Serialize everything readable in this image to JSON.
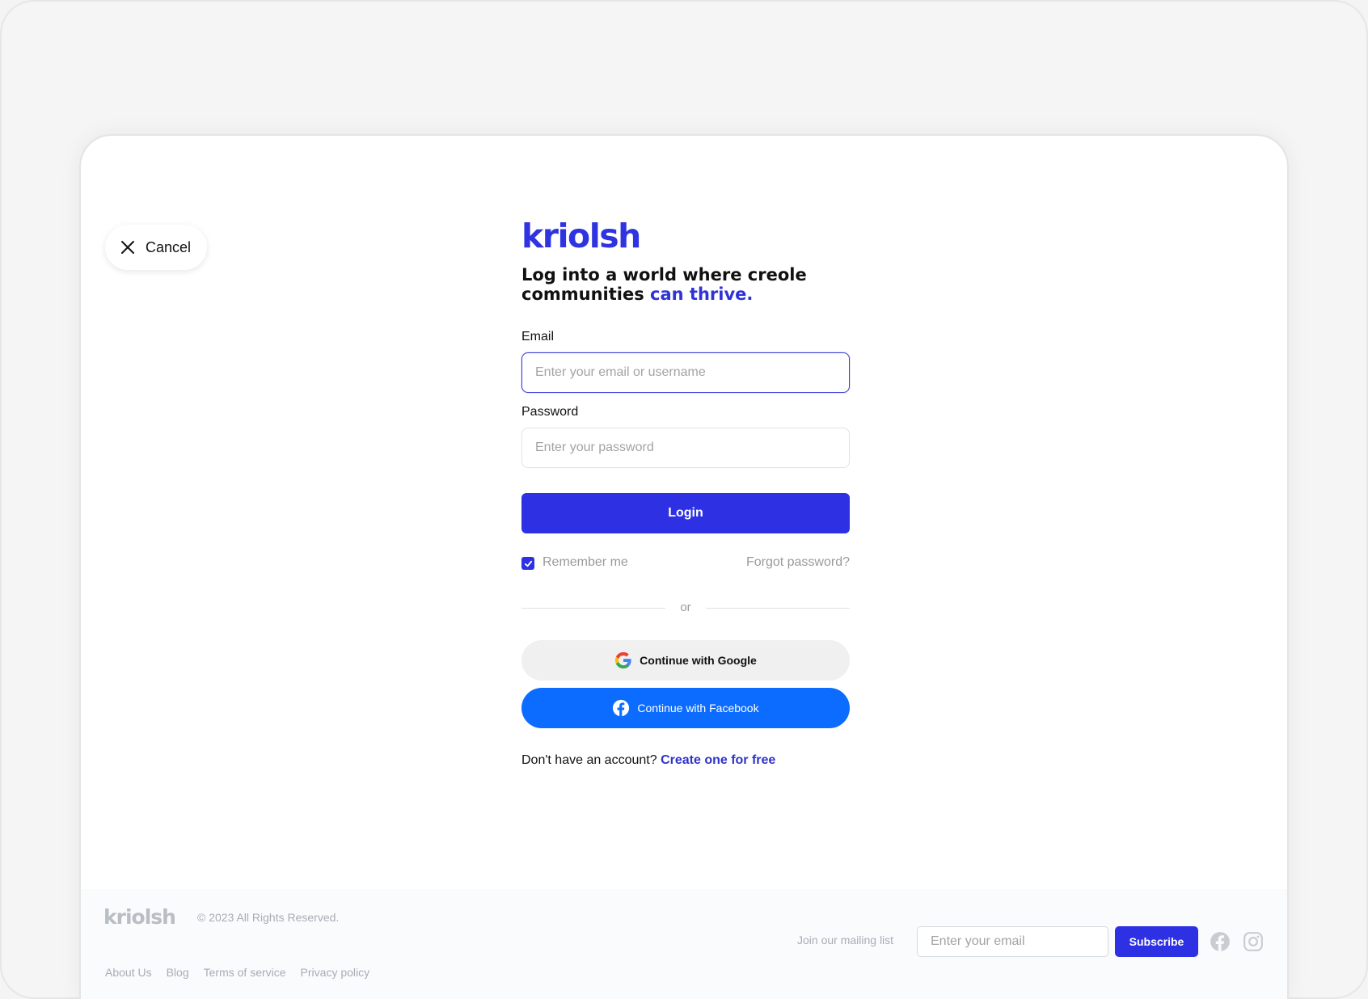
{
  "cancel": {
    "label": "Cancel",
    "icon": "close-icon"
  },
  "brand": {
    "logo_text": "kriolsh",
    "accent_color": "#2e31e3"
  },
  "headline": {
    "part1": "Log into a world where creole communities ",
    "accent": "can thrive."
  },
  "email": {
    "label": "Email",
    "placeholder": "Enter your email or username",
    "value": ""
  },
  "password": {
    "label": "Password",
    "placeholder": "Enter your password",
    "value": ""
  },
  "login": {
    "label": "Login"
  },
  "remember": {
    "label": "Remember me",
    "checked": true
  },
  "forgot": {
    "label": "Forgot password?"
  },
  "divider": {
    "label": "or"
  },
  "google": {
    "label": "Continue with Google",
    "icon": "google-icon"
  },
  "facebook": {
    "label": "Continue with Facebook",
    "icon": "facebook-icon",
    "color": "#0b6cff"
  },
  "signup": {
    "prompt": "Don't have an account? ",
    "link": "Create one for free"
  },
  "footer": {
    "logo_text": "kriolsh",
    "copyright": "© 2023 All Rights Reserved.",
    "links": [
      "About Us",
      "Blog",
      "Terms of service",
      "Privacy policy"
    ],
    "mailing_label": "Join our mailing list",
    "email_placeholder": "Enter your email",
    "subscribe_label": "Subscribe",
    "social_icons": [
      "facebook-icon",
      "instagram-icon"
    ]
  }
}
